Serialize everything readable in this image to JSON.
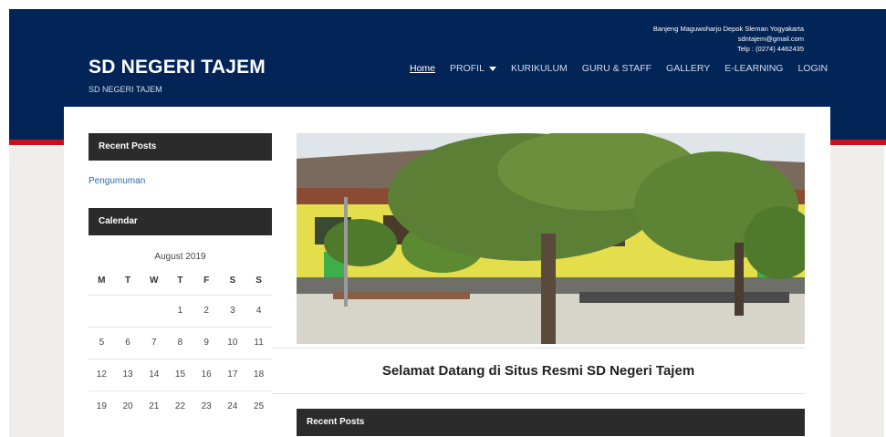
{
  "header": {
    "site_title": "SD NEGERI TAJEM",
    "site_subtitle": "SD NEGERI TAJEM",
    "contact": {
      "address": "Banjeng Maguwoharjo Depok Sleman Yogyakarta",
      "email": "sdntajem@gmail.com",
      "phone": "Telp : (0274) 4462435"
    }
  },
  "nav": {
    "items": [
      {
        "label": "Home"
      },
      {
        "label": "PROFIL"
      },
      {
        "label": "KURIKULUM"
      },
      {
        "label": "GURU & STAFF"
      },
      {
        "label": "GALLERY"
      },
      {
        "label": "E-LEARNING"
      },
      {
        "label": "LOGIN"
      }
    ],
    "active": "Home"
  },
  "sidebar": {
    "recent_posts_title": "Recent Posts",
    "recent_posts": [
      "Pengumuman"
    ],
    "calendar_title": "Calendar",
    "calendar": {
      "caption": "August 2019",
      "weekdays": [
        "M",
        "T",
        "W",
        "T",
        "F",
        "S",
        "S"
      ],
      "rows": [
        [
          "",
          "",
          "",
          "1",
          "2",
          "3",
          "4"
        ],
        [
          "5",
          "6",
          "7",
          "8",
          "9",
          "10",
          "11"
        ],
        [
          "12",
          "13",
          "14",
          "15",
          "16",
          "17",
          "18"
        ],
        [
          "19",
          "20",
          "21",
          "22",
          "23",
          "24",
          "25"
        ]
      ]
    }
  },
  "main": {
    "welcome": "Selamat Datang di Situs Resmi SD Negeri Tajem",
    "recent_posts_title": "Recent Posts"
  },
  "colors": {
    "header": "#022457",
    "accent_red": "#c3141b",
    "widget_header": "#2b2b2b",
    "link": "#2a6aa6"
  }
}
